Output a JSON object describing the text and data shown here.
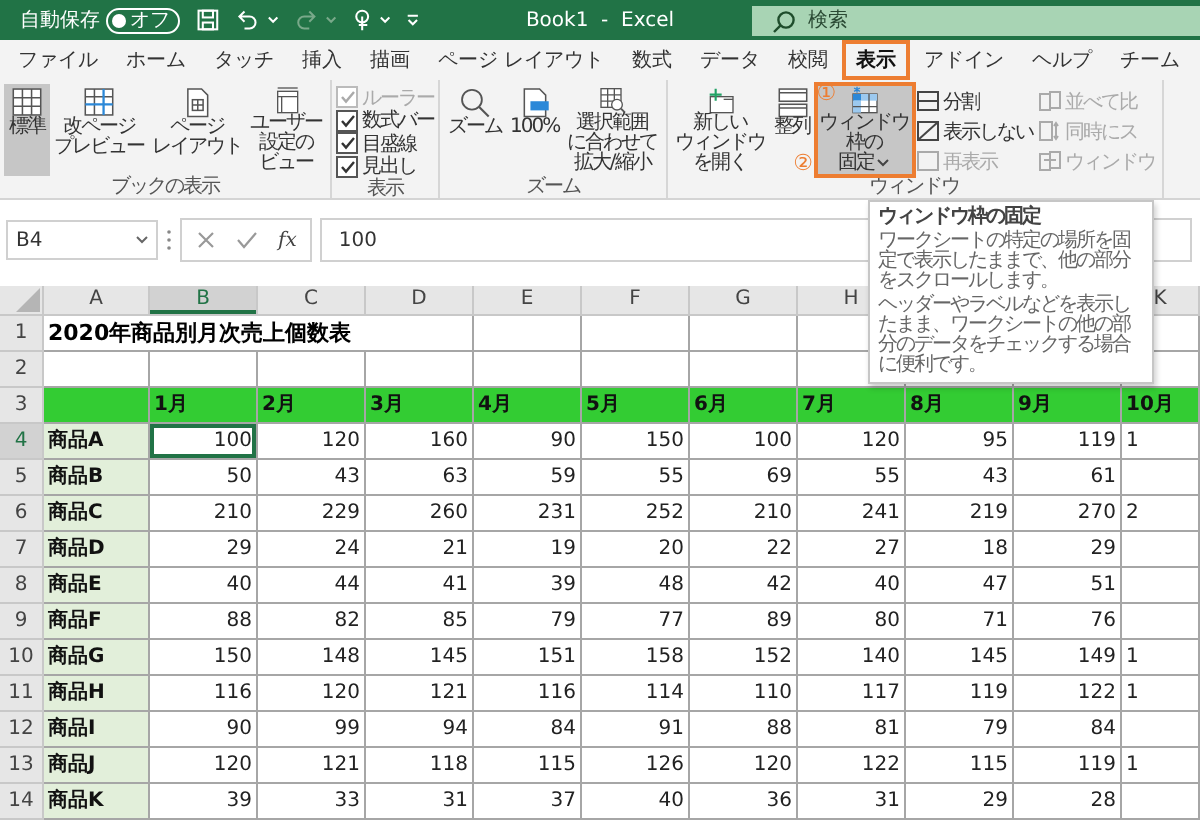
{
  "title_bar": {
    "autosave_label": "自動保存",
    "autosave_toggle": {
      "label": "オフ",
      "on": false
    },
    "title": "Book1  -  Excel",
    "search_placeholder": "検索"
  },
  "tabs": [
    {
      "label": "ファイル",
      "selected": false
    },
    {
      "label": "ホーム",
      "selected": false
    },
    {
      "label": "タッチ",
      "selected": false
    },
    {
      "label": "挿入",
      "selected": false
    },
    {
      "label": "描画",
      "selected": false
    },
    {
      "label": "ページ レイアウト",
      "selected": false
    },
    {
      "label": "数式",
      "selected": false
    },
    {
      "label": "データ",
      "selected": false
    },
    {
      "label": "校閲",
      "selected": false
    },
    {
      "label": "表示",
      "selected": true,
      "outlined": true,
      "annotation": "①"
    },
    {
      "label": "アドイン",
      "selected": false
    },
    {
      "label": "ヘルプ",
      "selected": false
    },
    {
      "label": "チーム",
      "selected": false
    }
  ],
  "ribbon": {
    "groups": [
      {
        "label": "ブックの表示",
        "items": [
          {
            "kind": "large",
            "lines": [
              "標準"
            ],
            "selected": true
          },
          {
            "kind": "large",
            "lines": [
              "改ページ",
              "プレビュー"
            ],
            "selected": false
          },
          {
            "kind": "large",
            "lines": [
              "ページ",
              "レイアウト"
            ],
            "selected": false
          },
          {
            "kind": "large",
            "lines": [
              "ユーザー",
              "設定の",
              "ビュー"
            ],
            "selected": false
          }
        ]
      },
      {
        "label": "表示",
        "items": [
          {
            "kind": "stack",
            "items": [
              {
                "kind": "check",
                "label": "ルーラー",
                "checked": true,
                "disabled": true
              },
              {
                "kind": "check",
                "label": "数式バー",
                "checked": true,
                "disabled": false
              },
              {
                "kind": "check",
                "label": "目盛線",
                "checked": true,
                "disabled": false
              },
              {
                "kind": "check",
                "label": "見出し",
                "checked": true,
                "disabled": false
              }
            ]
          }
        ]
      },
      {
        "label": "ズーム",
        "items": [
          {
            "kind": "large",
            "lines": [
              "ズーム"
            ],
            "selected": false
          },
          {
            "kind": "large",
            "lines": [
              "100%"
            ],
            "selected": false
          },
          {
            "kind": "large",
            "lines": [
              "選択範囲",
              "に合わせて",
              "拡大/縮小"
            ],
            "selected": false
          }
        ]
      },
      {
        "label": "ウィンドウ",
        "items": [
          {
            "kind": "large",
            "lines": [
              "新しい",
              "ウィンドウ",
              "を開く"
            ],
            "selected": false
          },
          {
            "kind": "large",
            "lines": [
              "整列"
            ],
            "selected": false
          },
          {
            "kind": "large",
            "lines": [
              "ウィンドウ",
              "枠の",
              "固定"
            ],
            "selected": false,
            "outlined": true,
            "dropdown": true,
            "annotation": "②"
          },
          {
            "kind": "stack",
            "items": [
              {
                "kind": "small",
                "label": "分割",
                "disabled": false
              },
              {
                "kind": "small",
                "label": "表示しない",
                "disabled": false
              },
              {
                "kind": "small",
                "label": "再表示",
                "disabled": true
              }
            ]
          },
          {
            "kind": "stack",
            "items": [
              {
                "kind": "small",
                "label": "並べて比",
                "disabled": true
              },
              {
                "kind": "small",
                "label": "同時にス",
                "disabled": true
              },
              {
                "kind": "small",
                "label": "ウィンドウ",
                "disabled": true
              }
            ]
          }
        ]
      }
    ]
  },
  "formula_bar": {
    "name_box": "B4",
    "function_label": "fx",
    "value": "100"
  },
  "tooltip": {
    "title": "ウィンドウ枠の固定",
    "paragraphs": [
      "ワークシートの特定の場所を固定で表示したままで、他の部分をスクロールします。",
      "ヘッダーやラベルなどを表示したまま、ワークシートの他の部分のデータをチェックする場合に便利です。"
    ]
  },
  "sheet": {
    "column_headers": [
      {
        "label": "A",
        "selected": false
      },
      {
        "label": "B",
        "selected": true
      },
      {
        "label": "C",
        "selected": false
      },
      {
        "label": "D",
        "selected": false
      },
      {
        "label": "E",
        "selected": false
      },
      {
        "label": "F",
        "selected": false
      },
      {
        "label": "G",
        "selected": false
      },
      {
        "label": "H",
        "selected": false
      },
      {
        "label": "K",
        "selected": false
      }
    ],
    "rows": [
      {
        "header": "1",
        "selected": false,
        "kind": "title",
        "cells": [
          "2020年商品別月次売上個数表"
        ]
      },
      {
        "header": "2",
        "selected": false,
        "kind": "blank"
      },
      {
        "header": "3",
        "selected": false,
        "kind": "months",
        "cells": [
          "1月",
          "2月",
          "3月",
          "4月",
          "5月",
          "6月",
          "7月",
          "8月",
          "9月",
          "10月"
        ]
      },
      {
        "header": "4",
        "selected": true,
        "kind": "data",
        "label": "商品A",
        "cells": [
          "100",
          "120",
          "160",
          "90",
          "150",
          "100",
          "120",
          "95",
          "119",
          "1"
        ]
      },
      {
        "header": "5",
        "selected": false,
        "kind": "data",
        "label": "商品B",
        "cells": [
          "50",
          "43",
          "63",
          "59",
          "55",
          "69",
          "55",
          "43",
          "61"
        ]
      },
      {
        "header": "6",
        "selected": false,
        "kind": "data",
        "label": "商品C",
        "cells": [
          "210",
          "229",
          "260",
          "231",
          "252",
          "210",
          "241",
          "219",
          "270",
          "2"
        ]
      },
      {
        "header": "7",
        "selected": false,
        "kind": "data",
        "label": "商品D",
        "cells": [
          "29",
          "24",
          "21",
          "19",
          "20",
          "22",
          "27",
          "18",
          "29"
        ]
      },
      {
        "header": "8",
        "selected": false,
        "kind": "data",
        "label": "商品E",
        "cells": [
          "40",
          "44",
          "41",
          "39",
          "48",
          "42",
          "40",
          "47",
          "51"
        ]
      },
      {
        "header": "9",
        "selected": false,
        "kind": "data",
        "label": "商品F",
        "cells": [
          "88",
          "82",
          "85",
          "79",
          "77",
          "89",
          "80",
          "71",
          "76"
        ]
      },
      {
        "header": "10",
        "selected": false,
        "kind": "data",
        "label": "商品G",
        "cells": [
          "150",
          "148",
          "145",
          "151",
          "158",
          "152",
          "140",
          "145",
          "149",
          "1"
        ]
      },
      {
        "header": "11",
        "selected": false,
        "kind": "data",
        "label": "商品H",
        "cells": [
          "116",
          "120",
          "121",
          "116",
          "114",
          "110",
          "117",
          "119",
          "122",
          "1"
        ]
      },
      {
        "header": "12",
        "selected": false,
        "kind": "data",
        "label": "商品I",
        "cells": [
          "90",
          "99",
          "94",
          "84",
          "91",
          "88",
          "81",
          "79",
          "84"
        ]
      },
      {
        "header": "13",
        "selected": false,
        "kind": "data",
        "label": "商品J",
        "cells": [
          "120",
          "121",
          "118",
          "115",
          "126",
          "120",
          "122",
          "115",
          "119",
          "1"
        ]
      },
      {
        "header": "14",
        "selected": false,
        "kind": "data",
        "label": "商品K",
        "cells": [
          "39",
          "33",
          "31",
          "37",
          "40",
          "36",
          "31",
          "29",
          "28"
        ]
      }
    ]
  }
}
